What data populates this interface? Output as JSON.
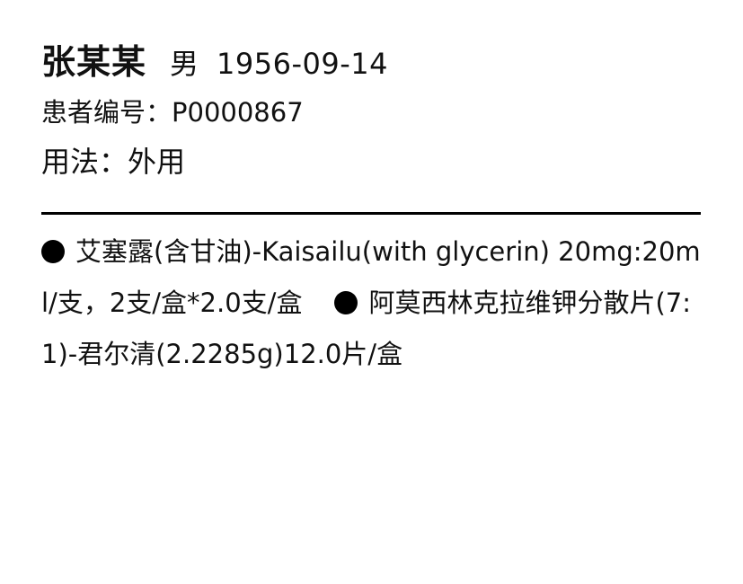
{
  "patient": {
    "name": "张某某",
    "gender": "男",
    "birth_date": "1956-09-14",
    "id_label": "患者编号：",
    "id_value": "P0000867",
    "usage_label": "用法：",
    "usage_value": "外用"
  },
  "medications": [
    {
      "text": "艾塞露(含甘油)-Kaisailu(with glycerin) 20mg:20ml/支，2支/盒*2.0支/盒"
    },
    {
      "text": "阿莫西林克拉维钾分散片(7:1)-君尔清(2.2285g)12.0片/盒"
    }
  ]
}
